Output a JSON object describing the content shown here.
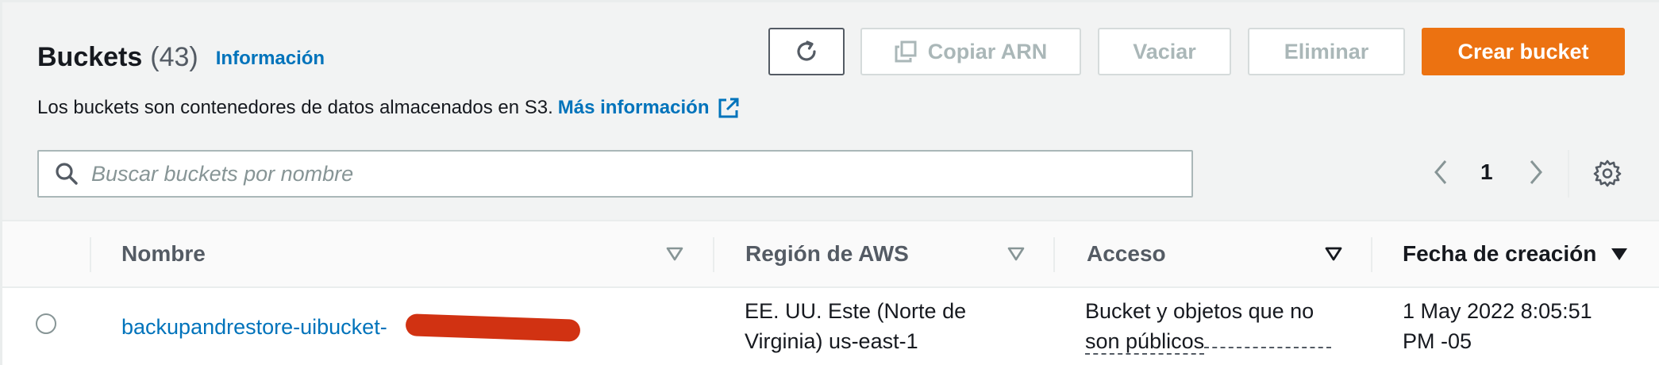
{
  "header": {
    "title": "Buckets",
    "count": "(43)",
    "info_link": "Información",
    "description": "Los buckets son contenedores de datos almacenados en S3.",
    "more_info_link": "Más información"
  },
  "toolbar": {
    "refresh_icon": "refresh-icon",
    "copy_arn_label": "Copiar ARN",
    "empty_label": "Vaciar",
    "delete_label": "Eliminar",
    "create_label": "Crear bucket"
  },
  "search": {
    "placeholder": "Buscar buckets por nombre",
    "value": ""
  },
  "pagination": {
    "current_page": "1"
  },
  "table": {
    "columns": [
      {
        "label": "Nombre"
      },
      {
        "label": "Región de AWS"
      },
      {
        "label": "Acceso"
      },
      {
        "label": "Fecha de creación"
      }
    ],
    "rows": [
      {
        "name": "backupandrestore-uibucket-",
        "region_line1": "EE. UU. Este (Norte de",
        "region_line2": "Virginia) us-east-1",
        "access_line1": "Bucket y objetos que no",
        "access_line2": "son públicos",
        "created_line1": "1 May 2022 8:05:51",
        "created_line2": "PM -05"
      }
    ]
  },
  "colors": {
    "primary_button": "#ec7211",
    "link": "#0073bb",
    "redaction": "#d13212"
  }
}
